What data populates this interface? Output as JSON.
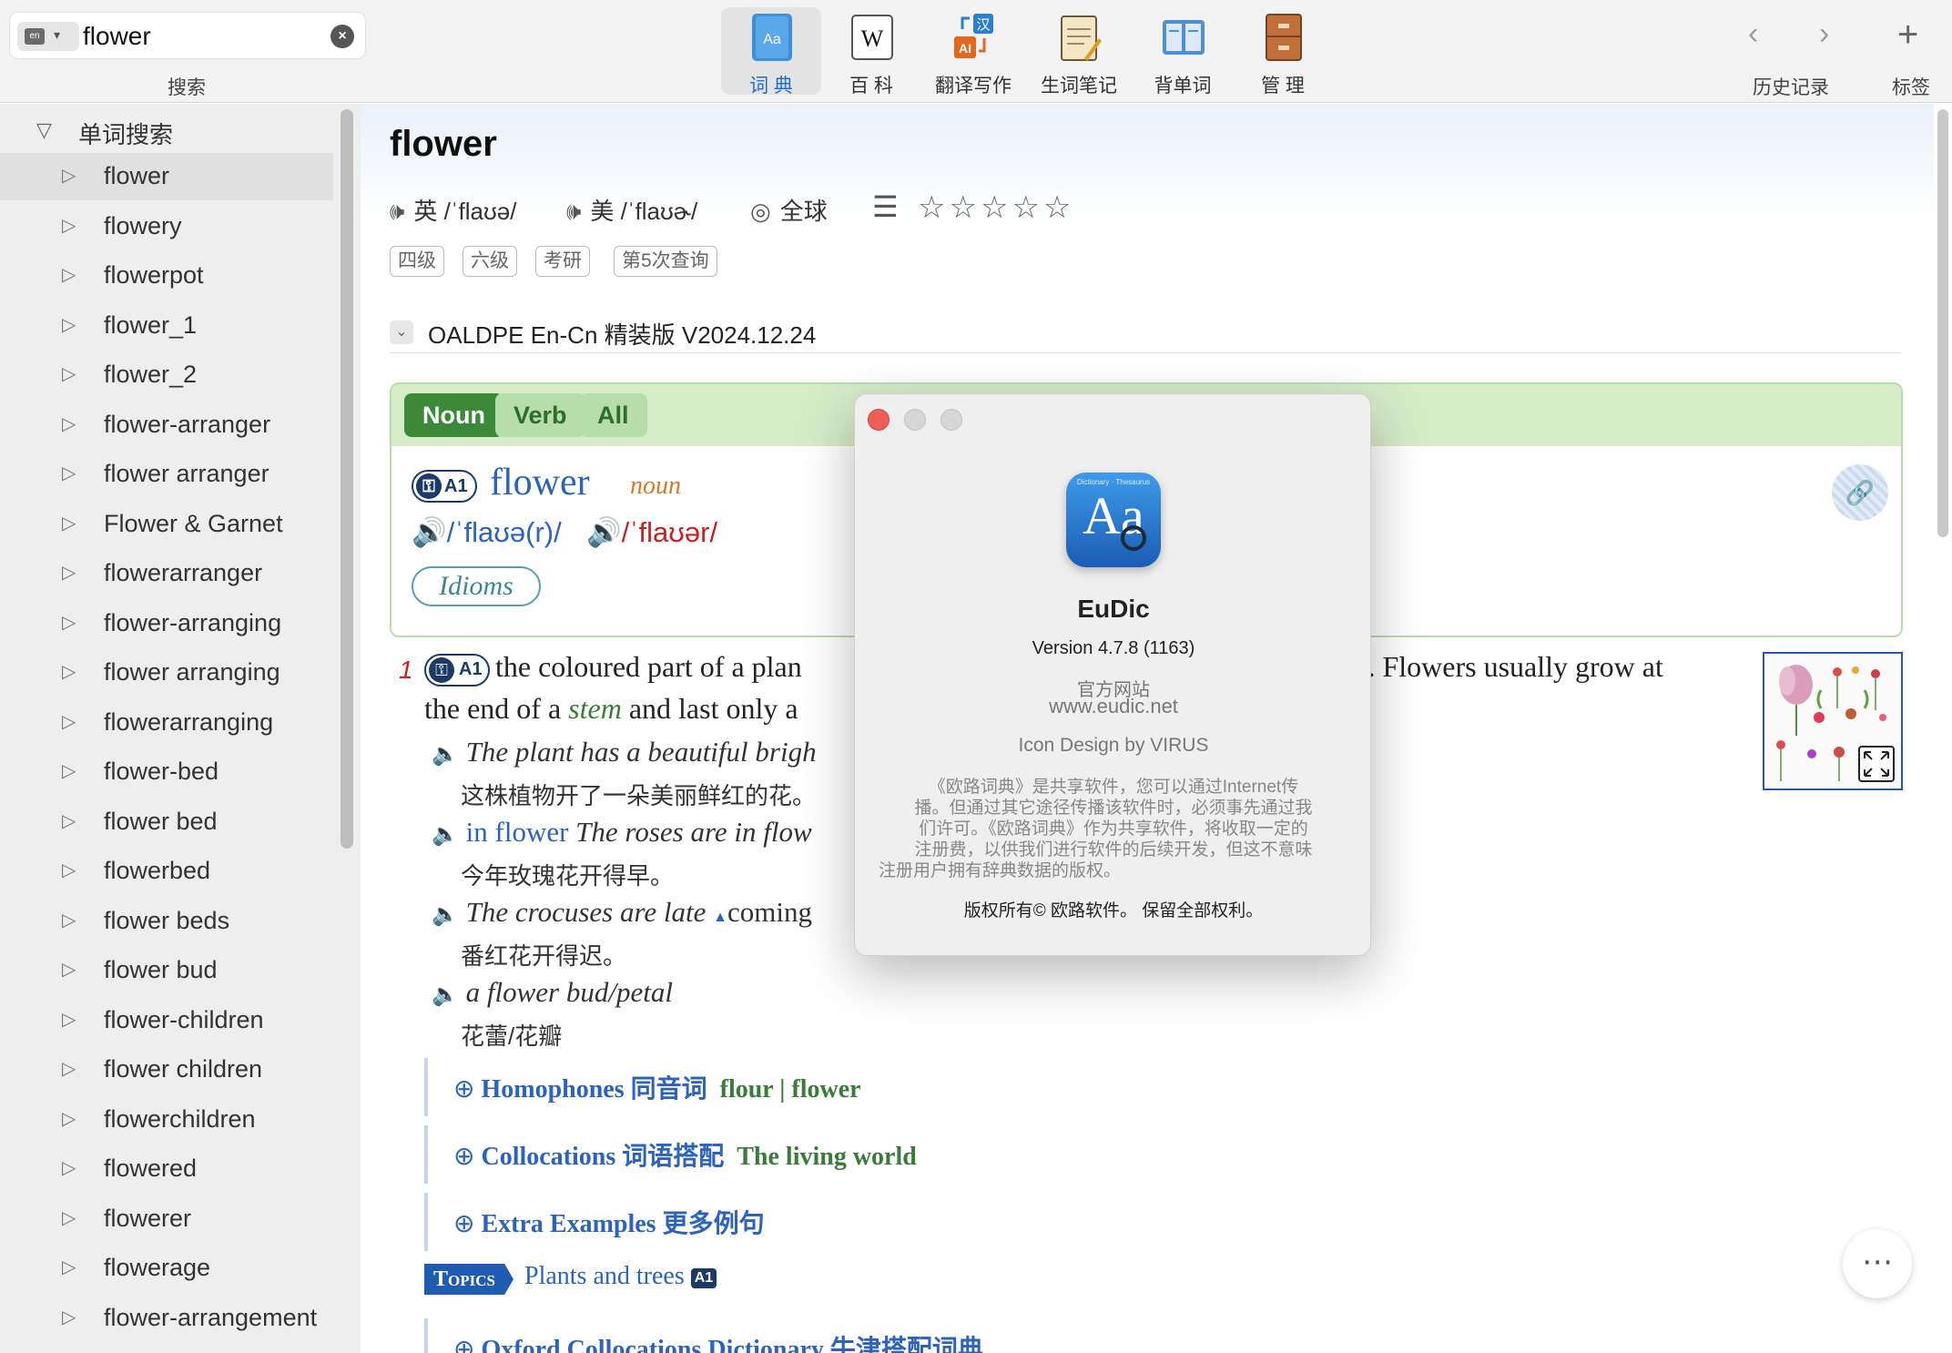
{
  "search": {
    "value": "flower",
    "label": "搜索",
    "lang": "en"
  },
  "toolbar": {
    "buttons": [
      {
        "label": "词 典"
      },
      {
        "label": "百 科"
      },
      {
        "label": "翻译写作"
      },
      {
        "label": "生词笔记"
      },
      {
        "label": "背单词"
      },
      {
        "label": "管 理"
      }
    ],
    "history_label": "历史记录",
    "tabs_label": "标签",
    "accent_color": "#1f6fd1"
  },
  "sidebar": {
    "header": "单词搜索",
    "items": [
      "flower",
      "flowery",
      "flowerpot",
      "flower_1",
      "flower_2",
      "flower-arranger",
      "flower arranger",
      "Flower & Garnet",
      "flowerarranger",
      "flower-arranging",
      "flower arranging",
      "flowerarranging",
      "flower-bed",
      "flower bed",
      "flowerbed",
      "flower beds",
      "flower bud",
      "flower-children",
      "flower children",
      "flowerchildren",
      "flowered",
      "flowerer",
      "flowerage",
      "flower-arrangement"
    ]
  },
  "entry": {
    "headword": "flower",
    "uk_pron": "英 /ˈflaʊə/",
    "us_pron": "美 /ˈflaʊɚ/",
    "global_label": "全球",
    "tags": [
      "四级",
      "六级",
      "考研",
      "第5次查询"
    ],
    "dict_name": "OALDPE En-Cn 精装版 V2024.12.24",
    "pos_tabs": [
      "Noun",
      "Verb",
      "All"
    ],
    "level": "A1",
    "word": "flower",
    "pos": "noun",
    "ipa_uk": "/ˈflaʊə(r)/",
    "ipa_us": "/ˈflaʊər/",
    "idioms": "Idioms"
  },
  "sense": {
    "number": "1",
    "level": "A1",
    "def_line1": "the coloured part of a plan",
    "def_line1_end": "s. Flowers usually grow at",
    "def_line2_a": "the end of a ",
    "def_line2_stem": "stem",
    "def_line2_b": " and last only a",
    "ex1": "The plant has a beautiful brigh",
    "ex1_zh": "这株植物开了一朵美丽鲜红的花。",
    "ex2_phrase": "in flower",
    "ex2": "The roses are in flow",
    "ex2_zh": "今年玫瑰花开得早。",
    "ex3": "The crocuses are late",
    "ex3_b": "coming",
    "ex3_zh": "番红花开得迟。",
    "ex4": "a flower bud/petal",
    "ex4_zh": "花蕾/花瓣",
    "homophones_label": "Homophones 同音词",
    "homophones_words": "flour  |  flower",
    "collocations_label": "Collocations 词语搭配",
    "collocations_topic": "The living world",
    "extra_examples": "Extra Examples 更多例句",
    "topics_badge": "Topics",
    "topics_text": "Plants and trees",
    "topics_level": "A1",
    "oxford_collocations": "Oxford Collocations Dictionary 牛津搭配词典"
  },
  "about": {
    "icon_caption": "Dictionary · Thesaurus",
    "app_name": "EuDic",
    "version": "Version 4.7.8 (1163)",
    "site_label": "官方网站",
    "site_url": "www.eudic.net",
    "icon_design": "Icon Design by VIRUS",
    "notice": [
      "《欧路词典》是共享软件，您可以通过Internet传",
      "播。但通过其它途径传播该软件时，必须事先通过我",
      "们许可。《欧路词典》作为共享软件，将收取一定的",
      "注册费，以供我们进行软件的后续开发，但这不意味",
      "注册用户拥有辞典数据的版权。"
    ],
    "copyright": "版权所有© 欧路软件。 保留全部权利。"
  }
}
